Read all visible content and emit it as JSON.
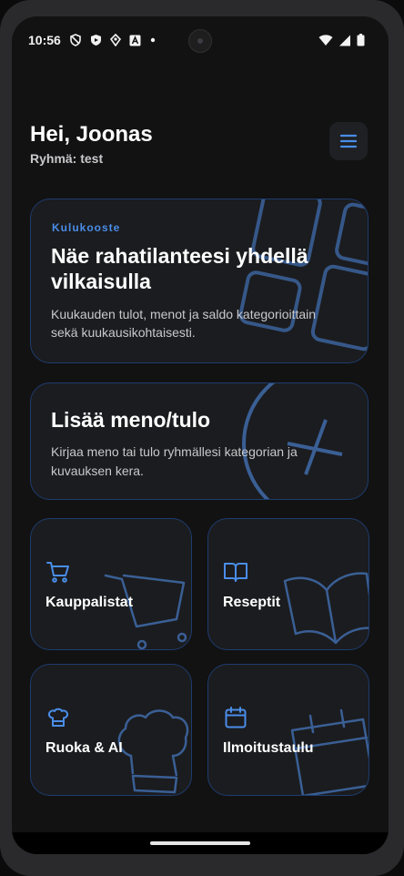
{
  "status_bar": {
    "time": "10:56"
  },
  "header": {
    "greeting": "Hei, Joonas",
    "group": "Ryhmä: test"
  },
  "summary_card": {
    "eyebrow": "Kulukooste",
    "title": "Näe rahatilanteesi yhdellä vilkaisulla",
    "description": "Kuukauden tulot, menot ja saldo kategorioittain sekä kuukausikohtaisesti."
  },
  "add_card": {
    "title": "Lisää meno/tulo",
    "description": "Kirjaa meno tai tulo ryhmällesi kategorian ja kuvauksen kera."
  },
  "tiles": [
    {
      "label": "Kauppalistat",
      "icon": "shopping-cart-icon"
    },
    {
      "label": "Reseptit",
      "icon": "book-open-icon"
    },
    {
      "label": "Ruoka & AI",
      "icon": "chef-hat-icon"
    },
    {
      "label": "Ilmoitustaulu",
      "icon": "calendar-icon"
    }
  ],
  "colors": {
    "accent": "#4a8de8",
    "background": "#121213",
    "card": "#1b1c1f",
    "card_border": "#1e3c6e"
  }
}
